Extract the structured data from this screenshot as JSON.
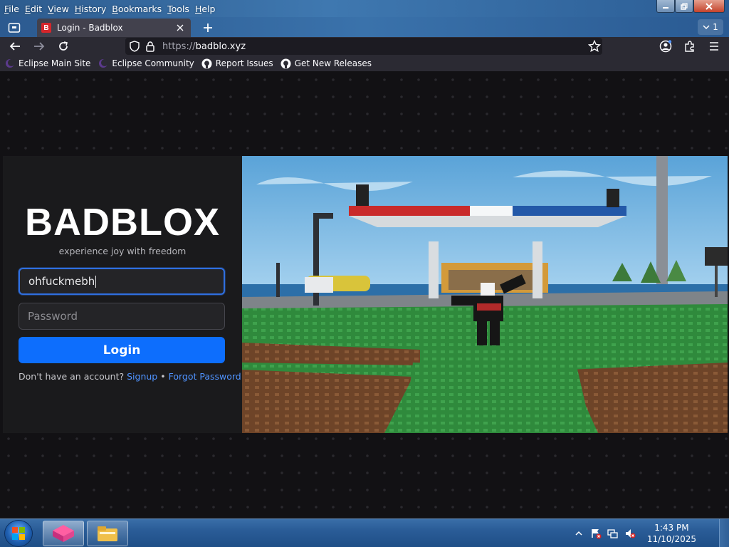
{
  "menu": [
    "File",
    "Edit",
    "View",
    "History",
    "Bookmarks",
    "Tools",
    "Help"
  ],
  "tab": {
    "title": "Login - Badblox",
    "favicon_letter": "B"
  },
  "tab_count": "1",
  "url": {
    "scheme": "https://",
    "host": "badblo.xyz"
  },
  "bookmarks": [
    {
      "label": "Eclipse Main Site",
      "icon": "eclipse-icon"
    },
    {
      "label": "Eclipse Community",
      "icon": "eclipse-icon"
    },
    {
      "label": "Report Issues",
      "icon": "github-icon"
    },
    {
      "label": "Get New Releases",
      "icon": "github-icon"
    }
  ],
  "login": {
    "logo": "BADBLOX",
    "tagline": "experience joy with freedom",
    "username_value": "ohfuckmebh",
    "password_placeholder": "Password",
    "button": "Login",
    "no_account_text": "Don't have an account?",
    "signup_link": "Signup",
    "separator": " • ",
    "forgot_link": "Forgot Password"
  },
  "taskbar": {
    "apps": [
      {
        "name": "firefox-eclipse-app",
        "state": "active"
      },
      {
        "name": "file-explorer-app",
        "state": "idle"
      }
    ],
    "clock_time": "1:43 PM",
    "clock_date": "11/10/2025"
  },
  "colors": {
    "accent_blue": "#0d6efd",
    "link_blue": "#4f93ff",
    "favicon_red": "#d6262b"
  }
}
